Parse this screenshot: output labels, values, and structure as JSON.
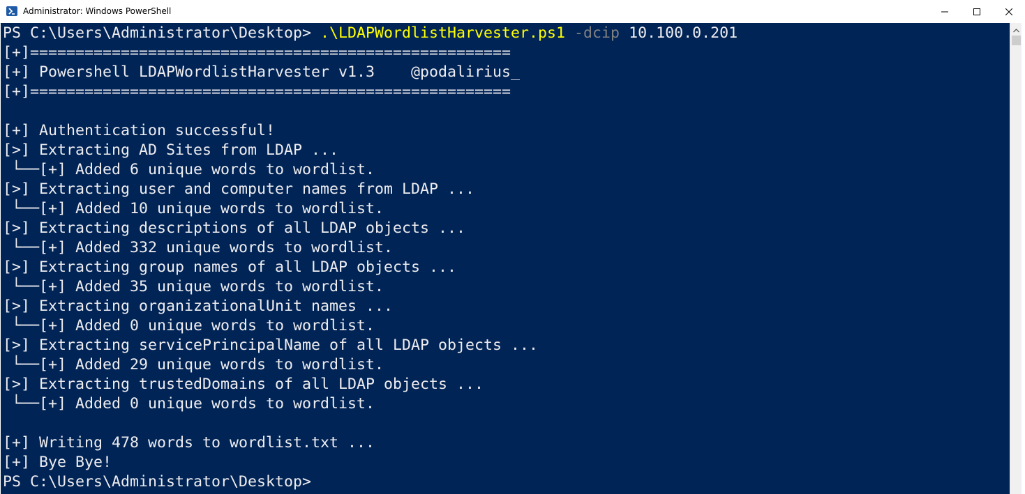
{
  "window": {
    "title": "Administrator: Windows PowerShell",
    "app_icon": "powershell-icon",
    "controls": {
      "minimize_icon": "minimize-icon",
      "maximize_icon": "maximize-icon",
      "close_icon": "close-icon"
    }
  },
  "colors": {
    "console_background": "#012456",
    "console_text": "#eeedf0",
    "command_text": "#ffff00",
    "parameter_text": "#808080"
  },
  "console": {
    "command": {
      "prompt": "PS C:\\Users\\Administrator\\Desktop> ",
      "script": ".\\LDAPWordlistHarvester.ps1",
      "param": " -dcip",
      "value": " 10.100.0.201"
    },
    "lines": [
      "[+]=====================================================",
      "[+] Powershell LDAPWordlistHarvester v1.3    @podalirius_",
      "[+]=====================================================",
      "",
      "[+] Authentication successful!",
      "[>] Extracting AD Sites from LDAP ...",
      " └──[+] Added 6 unique words to wordlist.",
      "[>] Extracting user and computer names from LDAP ...",
      " └──[+] Added 10 unique words to wordlist.",
      "[>] Extracting descriptions of all LDAP objects ...",
      " └──[+] Added 332 unique words to wordlist.",
      "[>] Extracting group names of all LDAP objects ...",
      " └──[+] Added 35 unique words to wordlist.",
      "[>] Extracting organizationalUnit names ...",
      " └──[+] Added 0 unique words to wordlist.",
      "[>] Extracting servicePrincipalName of all LDAP objects ...",
      " └──[+] Added 29 unique words to wordlist.",
      "[>] Extracting trustedDomains of all LDAP objects ...",
      " └──[+] Added 0 unique words to wordlist.",
      "",
      "[+] Writing 478 words to wordlist.txt ...",
      "[+] Bye Bye!"
    ],
    "final_prompt": "PS C:\\Users\\Administrator\\Desktop>"
  }
}
